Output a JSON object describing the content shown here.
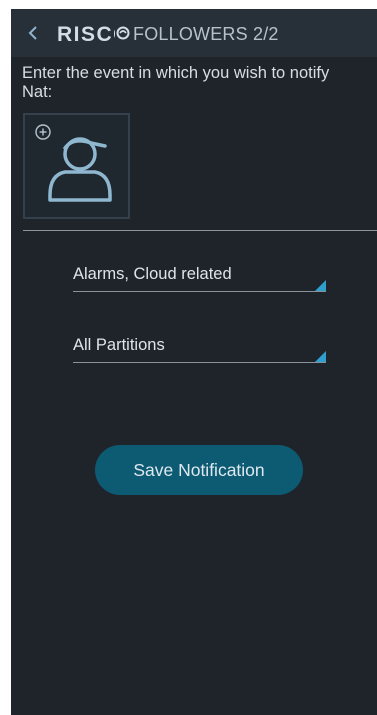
{
  "header": {
    "back_icon": "chevron-left-icon",
    "logo_text": "RISCO",
    "logo_icon": "risco-swirl-icon",
    "title": "FOLLOWERS 2/2"
  },
  "prompt": "Enter the event in which you wish to notify Nat:",
  "avatar": {
    "icon": "user-avatar-icon",
    "add_icon": "plus-circle-icon"
  },
  "selects": [
    {
      "value": "Alarms, Cloud related"
    },
    {
      "value": "All Partitions"
    }
  ],
  "save_button": "Save Notification",
  "colors": {
    "background": "#1f242b",
    "header": "#273038",
    "accent": "#2f9fd0",
    "button": "#0d5a73",
    "avatar_stroke": "#8fb8d0"
  }
}
